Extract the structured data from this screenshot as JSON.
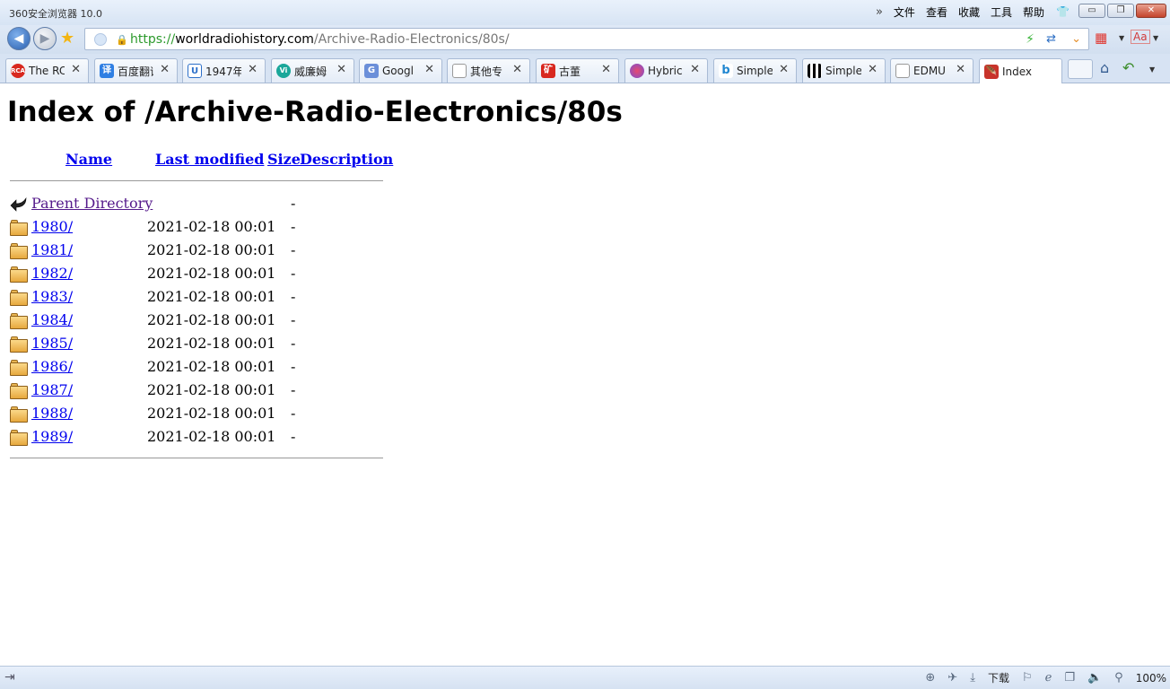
{
  "window": {
    "title": "360安全浏览器 10.0",
    "menu": [
      "文件",
      "查看",
      "收藏",
      "工具",
      "帮助"
    ],
    "min_label": "▭",
    "restore_label": "❐",
    "close_label": "✕"
  },
  "address_bar": {
    "protocol": "https://",
    "host": "worldradiohistory.com",
    "path": "/Archive-Radio-Electronics/80s/"
  },
  "tabs": [
    {
      "label": "The RC",
      "icon": "RCA",
      "color": "#d8281f",
      "active": false
    },
    {
      "label": "百度翻译",
      "icon": "译",
      "color": "#2f7fe3",
      "active": false
    },
    {
      "label": "1947年",
      "icon": "U",
      "color": "#ffffff",
      "active": false
    },
    {
      "label": "威廉姆",
      "icon": "Vi",
      "color": "#1aa79a",
      "active": false
    },
    {
      "label": "Googl",
      "icon": "G",
      "color": "#6b8fd9",
      "active": false
    },
    {
      "label": "其他专",
      "icon": "page",
      "color": "#ffffff",
      "active": false
    },
    {
      "label": "古董",
      "icon": "矿",
      "color": "#d8281f",
      "active": false
    },
    {
      "label": "Hybric",
      "icon": "H",
      "color": "#b04bc4",
      "active": false
    },
    {
      "label": "Simple",
      "icon": "b",
      "color": "#ffffff",
      "active": false
    },
    {
      "label": "Simple",
      "icon": "qr",
      "color": "#ffffff",
      "active": false
    },
    {
      "label": "EDMU",
      "icon": "page",
      "color": "#ffffff",
      "active": false
    },
    {
      "label": "Index",
      "icon": "apache",
      "color": "#c8332a",
      "active": true
    }
  ],
  "page": {
    "heading": "Index of /Archive-Radio-Electronics/80s",
    "columns": {
      "name": "Name",
      "last_modified": "Last modified",
      "size": "Size",
      "description": "Description"
    },
    "parent": {
      "name": "Parent Directory",
      "size": "-"
    },
    "rows": [
      {
        "name": "1980/",
        "modified": "2021-02-18 00:01",
        "size": "-"
      },
      {
        "name": "1981/",
        "modified": "2021-02-18 00:01",
        "size": "-"
      },
      {
        "name": "1982/",
        "modified": "2021-02-18 00:01",
        "size": "-"
      },
      {
        "name": "1983/",
        "modified": "2021-02-18 00:01",
        "size": "-"
      },
      {
        "name": "1984/",
        "modified": "2021-02-18 00:01",
        "size": "-"
      },
      {
        "name": "1985/",
        "modified": "2021-02-18 00:01",
        "size": "-"
      },
      {
        "name": "1986/",
        "modified": "2021-02-18 00:01",
        "size": "-"
      },
      {
        "name": "1987/",
        "modified": "2021-02-18 00:01",
        "size": "-"
      },
      {
        "name": "1988/",
        "modified": "2021-02-18 00:01",
        "size": "-"
      },
      {
        "name": "1989/",
        "modified": "2021-02-18 00:01",
        "size": "-"
      }
    ]
  },
  "status_bar": {
    "download_label": "下载",
    "zoom": "100%"
  }
}
